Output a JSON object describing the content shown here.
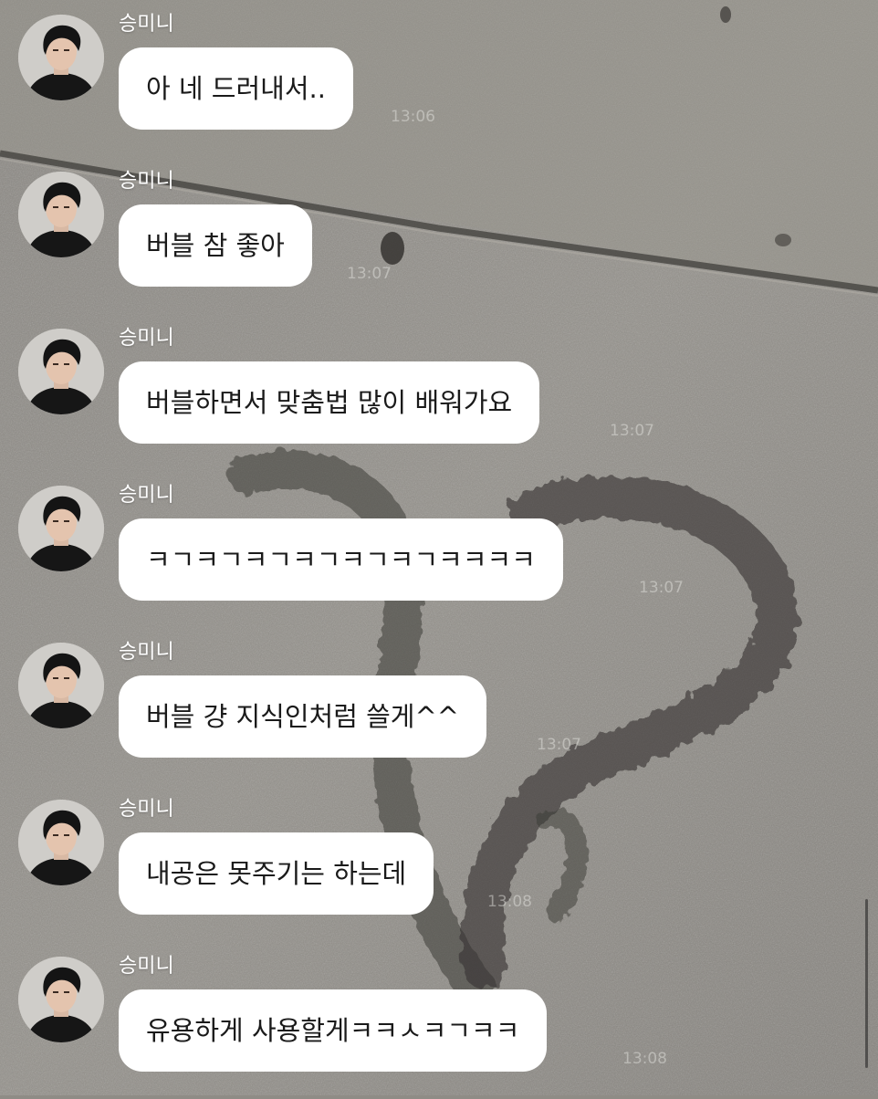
{
  "chat": {
    "messages": [
      {
        "sender": "승미니",
        "text": "아 네 드러내서..",
        "time": "13:06"
      },
      {
        "sender": "승미니",
        "text": "버블 참 좋아",
        "time": "13:07"
      },
      {
        "sender": "승미니",
        "text": "버블하면서 맞춤법 많이 배워가요",
        "time": "13:07"
      },
      {
        "sender": "승미니",
        "text": "ㅋㄱㅋㄱㅋㄱㅋㄱㅋㄱㅋㄱㅋㅋㅋㅋ",
        "time": "13:07"
      },
      {
        "sender": "승미니",
        "text": "버블 걍 지식인처럼 쓸게^^",
        "time": "13:07"
      },
      {
        "sender": "승미니",
        "text": "내공은 못주기는 하는데",
        "time": "13:08"
      },
      {
        "sender": "승미니",
        "text": "유용하게 사용할게ㅋㅋㅅㅋㄱㅋㅋ",
        "time": "13:08"
      }
    ]
  },
  "colors": {
    "bubble": "#ffffff",
    "sender_name": "#ffffff",
    "background": "#8f8c86"
  },
  "icons": {
    "avatar": "profile-photo"
  }
}
